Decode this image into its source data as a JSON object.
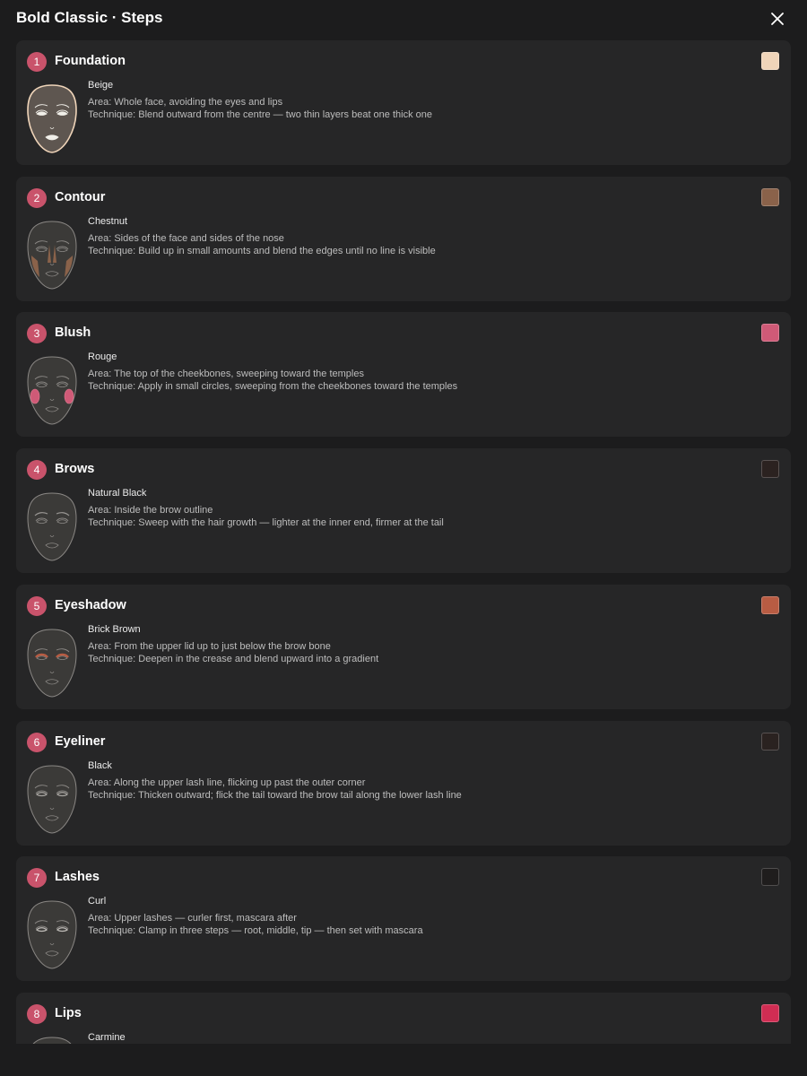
{
  "header": {
    "title": "Bold Classic · Steps"
  },
  "steps": [
    {
      "num": "1",
      "title": "Foundation",
      "shade": "Beige",
      "area": "Area: Whole face, avoiding the eyes and lips",
      "technique": "Technique: Blend outward from the centre — two thin layers beat one thick one",
      "swatch": "#efd4b9",
      "target": "face"
    },
    {
      "num": "2",
      "title": "Contour",
      "shade": "Chestnut",
      "area": "Area: Sides of the face and sides of the nose",
      "technique": "Technique: Build up in small amounts and blend the edges until no line is visible",
      "swatch": "#8a624a",
      "target": "contour"
    },
    {
      "num": "3",
      "title": "Blush",
      "shade": "Rouge",
      "area": "Area: The top of the cheekbones, sweeping toward the temples",
      "technique": "Technique: Apply in small circles, sweeping from the cheekbones toward the temples",
      "swatch": "#cf5a77",
      "target": "cheeks"
    },
    {
      "num": "4",
      "title": "Brows",
      "shade": "Natural Black",
      "area": "Area: Inside the brow outline",
      "technique": "Technique: Sweep with the hair growth — lighter at the inner end, firmer at the tail",
      "swatch": "#2b2220",
      "target": "brows"
    },
    {
      "num": "5",
      "title": "Eyeshadow",
      "shade": "Brick Brown",
      "area": "Area: From the upper lid up to just below the brow bone",
      "technique": "Technique: Deepen in the crease and blend upward into a gradient",
      "swatch": "#b85c43",
      "target": "lids"
    },
    {
      "num": "6",
      "title": "Eyeliner",
      "shade": "Black",
      "area": "Area: Along the upper lash line, flicking up past the outer corner",
      "technique": "Technique: Thicken outward; flick the tail toward the brow tail along the lower lash line",
      "swatch": "#2a2220",
      "target": "liner"
    },
    {
      "num": "7",
      "title": "Lashes",
      "shade": "Curl",
      "area": "Area: Upper lashes — curler first, mascara after",
      "technique": "Technique: Clamp in three steps — root, middle, tip — then set with mascara",
      "swatch": "#1f1d1d",
      "target": "lashes"
    },
    {
      "num": "8",
      "title": "Lips",
      "shade": "Carmine",
      "area": "",
      "technique": "",
      "swatch": "#d02d53",
      "target": "lips"
    }
  ]
}
